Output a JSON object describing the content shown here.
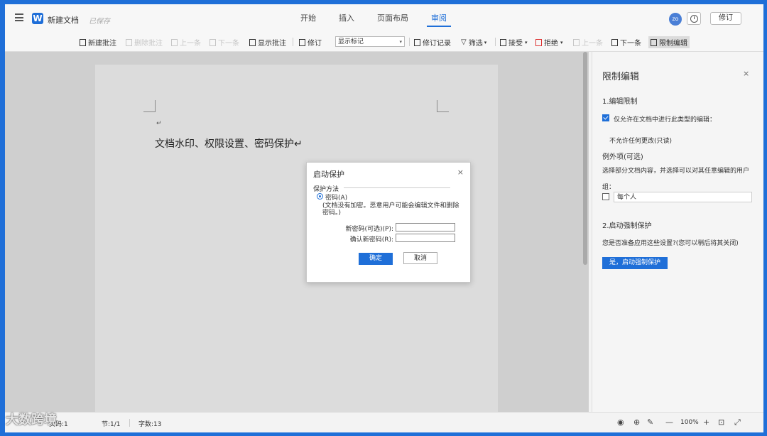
{
  "header": {
    "doc_title": "新建文档",
    "save_status": "已保存",
    "tabs": [
      {
        "label": "开始"
      },
      {
        "label": "插入"
      },
      {
        "label": "页面布局"
      },
      {
        "label": "审阅",
        "active": true
      }
    ],
    "avatar_text": "zo",
    "revise_label": "修订"
  },
  "toolbar": {
    "new_comment": "新建批注",
    "delete_comment": "删除批注",
    "prev_comment": "上一条",
    "next_comment": "下一条",
    "show_comments": "显示批注",
    "revise": "修订",
    "markup_select": "显示标记",
    "revision_record": "修订记录",
    "filter": "筛选",
    "accept": "接受",
    "reject": "拒绝",
    "prev_change": "上一条",
    "next_change": "下一条",
    "restrict_edit": "限制编辑"
  },
  "document": {
    "paragraph_mark": "↵",
    "text": "文档水印、权限设置、密码保护↵"
  },
  "dialog": {
    "title": "启动保护",
    "close": "×",
    "method_label": "保护方法",
    "option_password": "密码(A)",
    "note": "(文档没有加密。恶意用户可能会编辑文件和删除密码。)",
    "new_password_label": "新密码(可选)(P):",
    "confirm_password_label": "确认新密码(R):",
    "ok": "确定",
    "cancel": "取消"
  },
  "panel": {
    "title": "限制编辑",
    "close": "×",
    "section1": "1.编辑限制",
    "allow_only_label": "仅允许在文档中进行此类型的编辑：",
    "mode": "不允许任何更改(只读)",
    "exceptions_title": "例外项(可选)",
    "exceptions_desc": "选择部分文档内容，并选择可以对其任意编辑的用户",
    "group_label": "组：",
    "everyone": "每个人",
    "section2": "2.启动强制保护",
    "prompt": "您是否准备应用这些设置?(您可以稍后将其关闭)",
    "start_button": "是，启动强制保护"
  },
  "statusbar": {
    "page": "页码:1",
    "section": "节:1/1",
    "word_count": "字数:13",
    "zoom": "100%"
  },
  "watermark": "大数跨境"
}
